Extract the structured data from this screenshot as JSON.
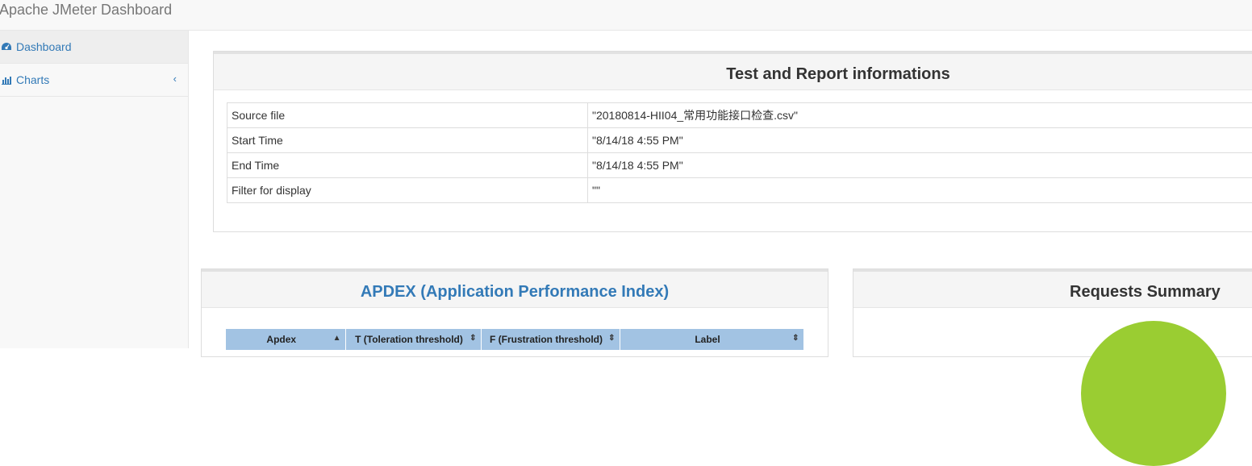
{
  "app": {
    "title": "Apache JMeter Dashboard"
  },
  "sidebar": {
    "items": [
      {
        "label": "Dashboard",
        "icon": "dashboard-icon",
        "active": true
      },
      {
        "label": "Charts",
        "icon": "bar-chart-icon",
        "active": false,
        "expand_icon": "chevron-left-icon"
      }
    ]
  },
  "test_info": {
    "title": "Test and Report informations",
    "rows": [
      {
        "key": "Source file",
        "value": "\"20180814-HII04_常用功能接口检查.csv\""
      },
      {
        "key": "Start Time",
        "value": "\"8/14/18 4:55 PM\""
      },
      {
        "key": "End Time",
        "value": "\"8/14/18 4:55 PM\""
      },
      {
        "key": "Filter for display",
        "value": "\"\""
      }
    ]
  },
  "apdex": {
    "title": "APDEX (Application Performance Index)",
    "title_color": "#337ab7",
    "columns": [
      {
        "label": "Apdex",
        "sort_icon": "sort-asc-icon"
      },
      {
        "label": "T (Toleration threshold)",
        "sort_icon": "sort-icon"
      },
      {
        "label": "F (Frustration threshold)",
        "sort_icon": "sort-icon"
      },
      {
        "label": "Label",
        "sort_icon": "sort-icon"
      }
    ]
  },
  "requests_summary": {
    "title": "Requests Summary",
    "pie_color": "#9acd32"
  },
  "colors": {
    "link": "#337ab7",
    "header_bg": "#a2c3e3",
    "pie_pass": "#9acd32"
  }
}
